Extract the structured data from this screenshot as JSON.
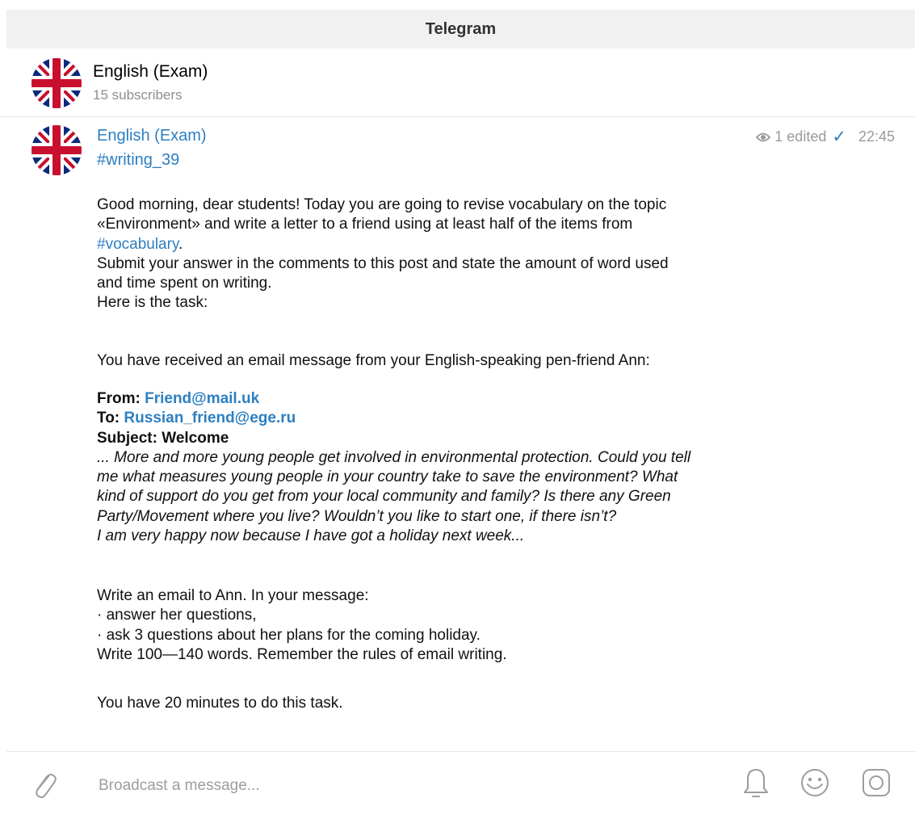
{
  "window": {
    "title": "Telegram"
  },
  "channel": {
    "name": "English (Exam)",
    "subscribers": "15 subscribers"
  },
  "post": {
    "author": "English (Exam)",
    "hashtag": "#writing_39",
    "views": "1",
    "edited_label": "edited",
    "time": "22:45",
    "intro": {
      "line1": "Good morning, dear students! Today you are going to revise vocabulary on the topic",
      "line2": "«Environment» and write a letter to a friend using at least half of the items from",
      "vocab_link": "#vocabulary",
      "vocab_suffix": ".",
      "line4": "Submit your answer in the comments to this post and state the amount of word used",
      "line5": "and time spent on writing.",
      "line6": "Here is the task:"
    },
    "received_line": "You have received an email message from your English-speaking pen-friend Ann:",
    "email": {
      "from_label": "From:",
      "from_value": "Friend@mail.uk",
      "to_label": "To:",
      "to_value": "Russian_friend@ege.ru",
      "subject": "Subject: Welcome",
      "body": [
        "... More and more young people get involved in environmental protection. Could you tell",
        "me what measures young people in your country take to save the environment? What",
        "kind of support do you get from your local community and family? Is there any Green",
        "Party/Movement where you live? Wouldn’t you like to start one, if there isn’t?",
        "I am very happy now because I have got a holiday next week..."
      ]
    },
    "task": [
      "Write an email to Ann. In your message:",
      "· answer her questions,",
      "· ask 3 questions about her plans for the coming holiday.",
      "Write 100—140 words. Remember the rules of email writing."
    ],
    "time_limit": "You have 20 minutes to do this task."
  },
  "composer": {
    "placeholder": "Broadcast a message..."
  },
  "icons": {
    "attach": "paperclip-icon",
    "bell": "bell-icon",
    "emoji": "emoji-icon",
    "camera": "camera-icon",
    "views": "eye-icon",
    "check": "checkmark-icon",
    "avatar": "union-jack-flag"
  },
  "colors": {
    "link": "#2d7fc1",
    "titlebar_bg": "#f1f1f1",
    "muted": "#9a9a9a"
  }
}
